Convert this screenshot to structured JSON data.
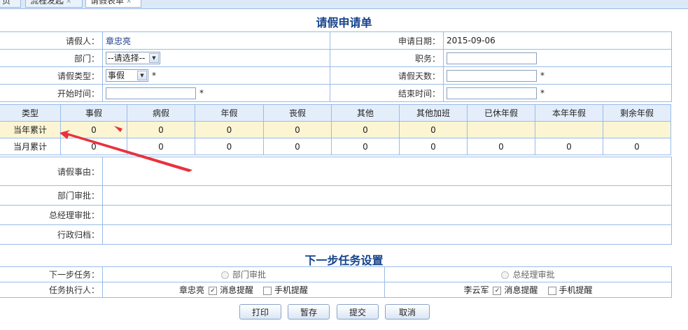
{
  "tabs": [
    {
      "label": "页",
      "closable": false
    },
    {
      "label": "流程发起",
      "closable": true
    },
    {
      "label": "请假表单",
      "closable": true
    }
  ],
  "form": {
    "title": "请假申请单",
    "applicant_label": "请假人：",
    "applicant_value": "章忠亮",
    "apply_date_label": "申请日期：",
    "apply_date_value": "2015-09-06",
    "dept_label": "部门：",
    "dept_selected": "--请选择--",
    "position_label": "职务：",
    "position_value": "",
    "leave_type_label": "请假类型：",
    "leave_type_selected": "事假",
    "days_label": "请假天数：",
    "days_value": "",
    "start_label": "开始时间：",
    "start_value": "",
    "end_label": "结束时间：",
    "end_value": "",
    "required_mark": "*"
  },
  "stats": {
    "headers": [
      "类型",
      "事假",
      "病假",
      "年假",
      "丧假",
      "其他",
      "其他加班",
      "已休年假",
      "本年年假",
      "剩余年假"
    ],
    "rows": [
      {
        "label": "当年累计",
        "values": [
          "0",
          "0",
          "0",
          "0",
          "0",
          "0",
          "",
          "",
          ""
        ]
      },
      {
        "label": "当月累计",
        "values": [
          "0",
          "0",
          "0",
          "0",
          "0",
          "0",
          "0",
          "0",
          "0"
        ]
      }
    ]
  },
  "approvals": {
    "reason_label": "请假事由：",
    "dept_approval_label": "部门审批：",
    "gm_approval_label": "总经理审批：",
    "admin_archive_label": "行政归档："
  },
  "next_step": {
    "title": "下一步任务设置",
    "task_label": "下一步任务：",
    "task_option_1": "部门审批",
    "task_option_2": "总经理审批",
    "executor_label": "任务执行人：",
    "executor_1": "章忠亮",
    "executor_2": "李云军",
    "msg_remind_label": "消息提醒",
    "phone_remind_label": "手机提醒"
  },
  "buttons": {
    "print": "打印",
    "save": "暂存",
    "submit": "提交",
    "cancel": "取消"
  },
  "colors": {
    "border": "#99bbe8",
    "title": "#15428b",
    "highlight_row": "#fbf5d4",
    "annotation": "#e8323c"
  }
}
